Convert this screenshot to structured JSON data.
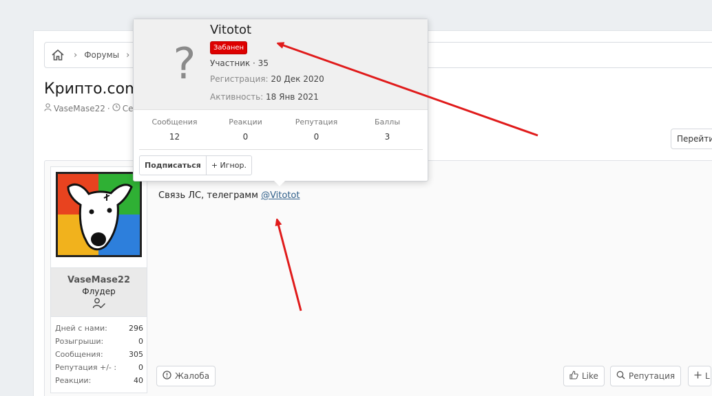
{
  "breadcrumb": {
    "forums_label": "Форумы"
  },
  "thread": {
    "title": "Крипто.com",
    "author": "VaseMase22",
    "date_partial": "Се"
  },
  "goto_label": "Перейти",
  "post": {
    "message_text": "Связь ЛС, телеграмм ",
    "mention": "@Vitotot",
    "report_label": "Жалоба",
    "like_label": "Like",
    "reputation_label": "Репутация",
    "extra_label": "L"
  },
  "user": {
    "name": "VaseMase22",
    "title": "Флудер",
    "stats": [
      {
        "label": "Дней с нами:",
        "value": "296"
      },
      {
        "label": "Розыгрыши:",
        "value": "0"
      },
      {
        "label": "Сообщения:",
        "value": "305"
      },
      {
        "label": "Репутация +/- :",
        "value": "0"
      },
      {
        "label": "Реакции:",
        "value": "40"
      }
    ]
  },
  "tooltip": {
    "avatar_glyph": "?",
    "name": "Vitotot",
    "banned_label": "Забанен",
    "role": "Участник · 35",
    "reg_label": "Регистрация: ",
    "reg_value": "20 Дек 2020",
    "act_label": "Активность: ",
    "act_value": "18 Янв 2021",
    "stats": [
      {
        "label": "Сообщения",
        "value": "12"
      },
      {
        "label": "Реакции",
        "value": "0"
      },
      {
        "label": "Репутация",
        "value": "0"
      },
      {
        "label": "Баллы",
        "value": "3"
      }
    ],
    "follow_label": "Подписаться",
    "ignore_label": "+ Игнор."
  },
  "colors": {
    "banned": "#dd0000",
    "arrow": "#e01b1b",
    "mention": "#2f5f8a"
  }
}
